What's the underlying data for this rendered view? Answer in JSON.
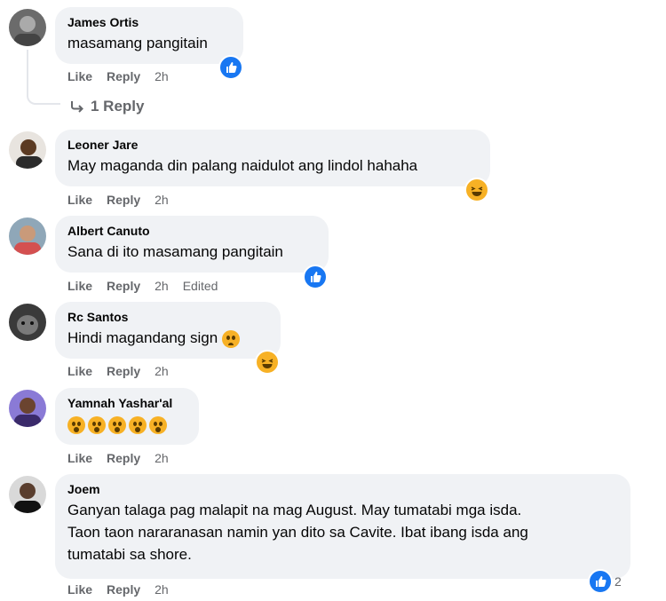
{
  "comments": [
    {
      "name": "James Ortis",
      "text": "masamang pangitain",
      "like": "Like",
      "reply": "Reply",
      "time": "2h"
    },
    {
      "name": "Leoner Jare",
      "text": "May maganda din palang naidulot ang lindol hahaha",
      "like": "Like",
      "reply": "Reply",
      "time": "2h"
    },
    {
      "name": "Albert Canuto",
      "text": "Sana di ito masamang pangitain",
      "like": "Like",
      "reply": "Reply",
      "time": "2h",
      "edited": "Edited"
    },
    {
      "name": "Rc Santos",
      "text": "Hindi magandang sign",
      "like": "Like",
      "reply": "Reply",
      "time": "2h"
    },
    {
      "name": "Yamnah Yashar'al",
      "text": "",
      "like": "Like",
      "reply": "Reply",
      "time": "2h"
    },
    {
      "name": "Joem",
      "text": "Ganyan talaga pag malapit na mag August. May tumatabi mga isda.\nTaon taon nararanasan namin yan dito sa Cavite. Ibat ibang isda ang\ntumatabi sa shore.",
      "like": "Like",
      "reply": "Reply",
      "time": "2h",
      "reaction_count": "2"
    }
  ],
  "reply_link": "1 Reply",
  "icons": {
    "like_reaction": "like-reaction-icon",
    "haha_reaction": "haha-reaction-icon",
    "wow_emoji": "wow-emoji-icon",
    "reply_arrow": "reply-arrow-icon"
  },
  "colors": {
    "like_blue": "#1877f2",
    "haha_yellow": "#f7b125",
    "bubble": "#f0f2f5",
    "meta": "#65676b"
  }
}
